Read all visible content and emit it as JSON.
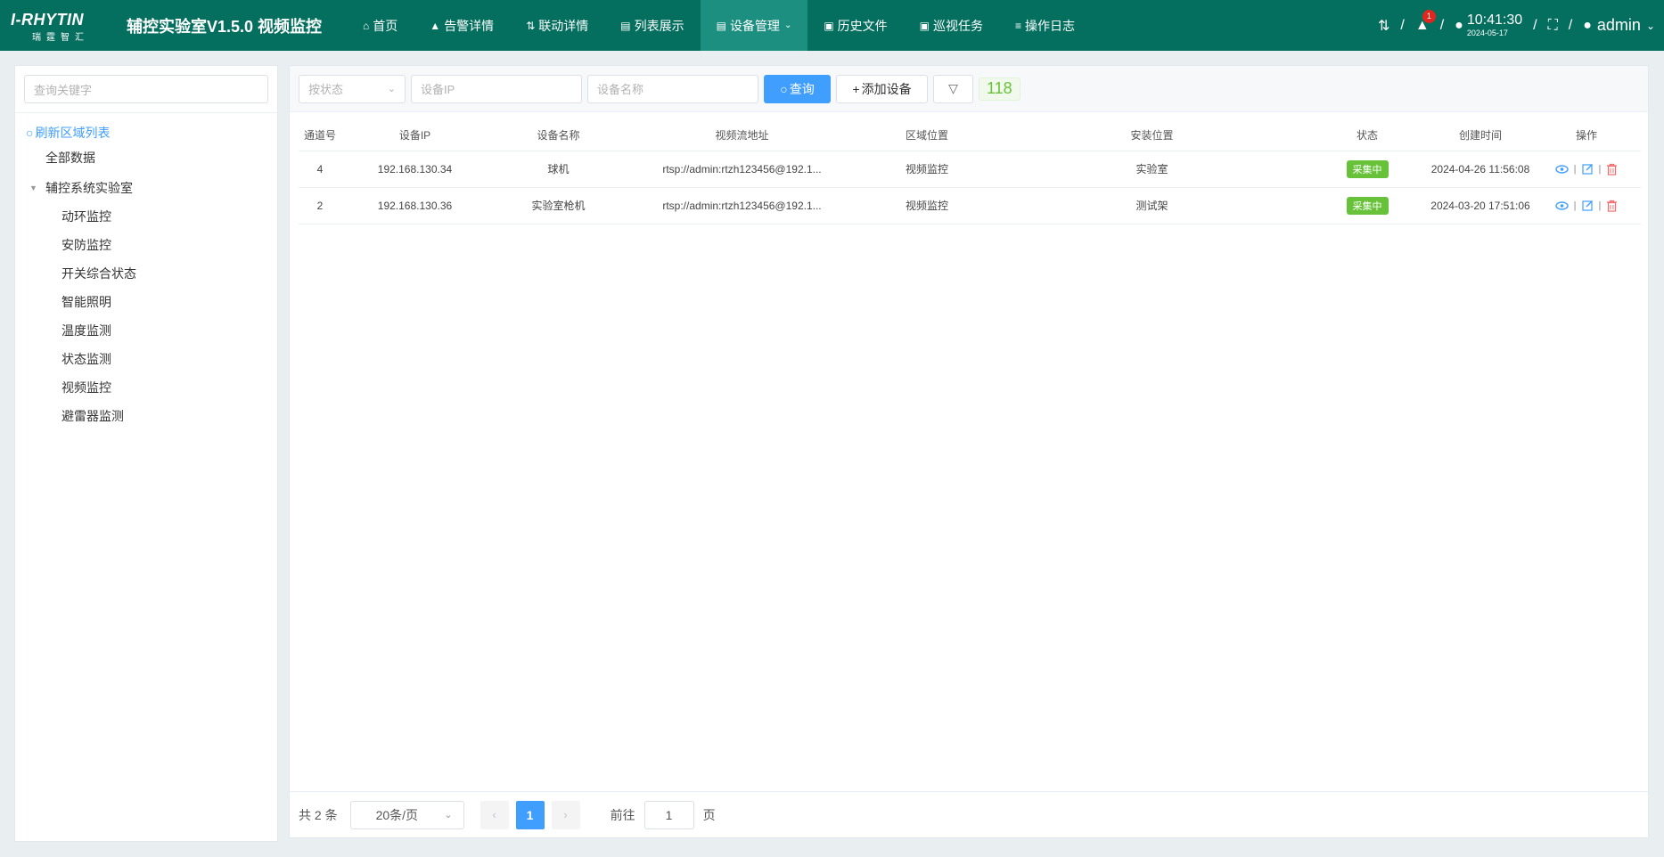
{
  "header": {
    "logo_line1": "I-RHYTIN",
    "logo_line2": "瑞霆智汇",
    "app_title": "辅控实验室V1.5.0 视频监控",
    "nav": [
      {
        "label": "首页",
        "icon": "home-icon"
      },
      {
        "label": "告警详情",
        "icon": "warning-icon"
      },
      {
        "label": "联动详情",
        "icon": "link-icon"
      },
      {
        "label": "列表展示",
        "icon": "list-icon"
      },
      {
        "label": "设备管理",
        "icon": "device-icon",
        "active": true
      },
      {
        "label": "历史文件",
        "icon": "file-icon"
      },
      {
        "label": "巡视任务",
        "icon": "patrol-icon"
      },
      {
        "label": "操作日志",
        "icon": "log-icon"
      }
    ],
    "alarm_count": "1",
    "time": "10:41:30",
    "date": "2024-05-17",
    "user": "admin"
  },
  "sidebar": {
    "search_placeholder": "查询关键字",
    "refresh_label": "刷新区域列表",
    "all_data": "全部数据",
    "root": "辅控系统实验室",
    "children": [
      "动环监控",
      "安防监控",
      "开关综合状态",
      "智能照明",
      "温度监测",
      "状态监测",
      "视频监控",
      "避雷器监测"
    ]
  },
  "toolbar": {
    "status_placeholder": "按状态",
    "ip_placeholder": "设备IP",
    "name_placeholder": "设备名称",
    "query_label": "查询",
    "add_label": "添加设备",
    "count": "118"
  },
  "table": {
    "columns": [
      "通道号",
      "设备IP",
      "设备名称",
      "视频流地址",
      "区域位置",
      "安装位置",
      "状态",
      "创建时间",
      "操作"
    ],
    "rows": [
      {
        "channel": "4",
        "ip": "192.168.130.34",
        "name": "球机",
        "stream": "rtsp://admin:rtzh123456@192.1...",
        "area": "视频监控",
        "location": "实验室",
        "status": "采集中",
        "created": "2024-04-26 11:56:08"
      },
      {
        "channel": "2",
        "ip": "192.168.130.36",
        "name": "实验室枪机",
        "stream": "rtsp://admin:rtzh123456@192.1...",
        "area": "视频监控",
        "location": "测试架",
        "status": "采集中",
        "created": "2024-03-20 17:51:06"
      }
    ]
  },
  "pager": {
    "total": "共 2 条",
    "page_size": "20条/页",
    "current": "1",
    "goto_label": "前往",
    "goto_value": "1",
    "unit": "页"
  },
  "colors": {
    "header_bg": "#046f5f",
    "nav_active": "#1d8f80",
    "primary": "#409eff",
    "success": "#67c23a",
    "danger": "#e0261d"
  }
}
